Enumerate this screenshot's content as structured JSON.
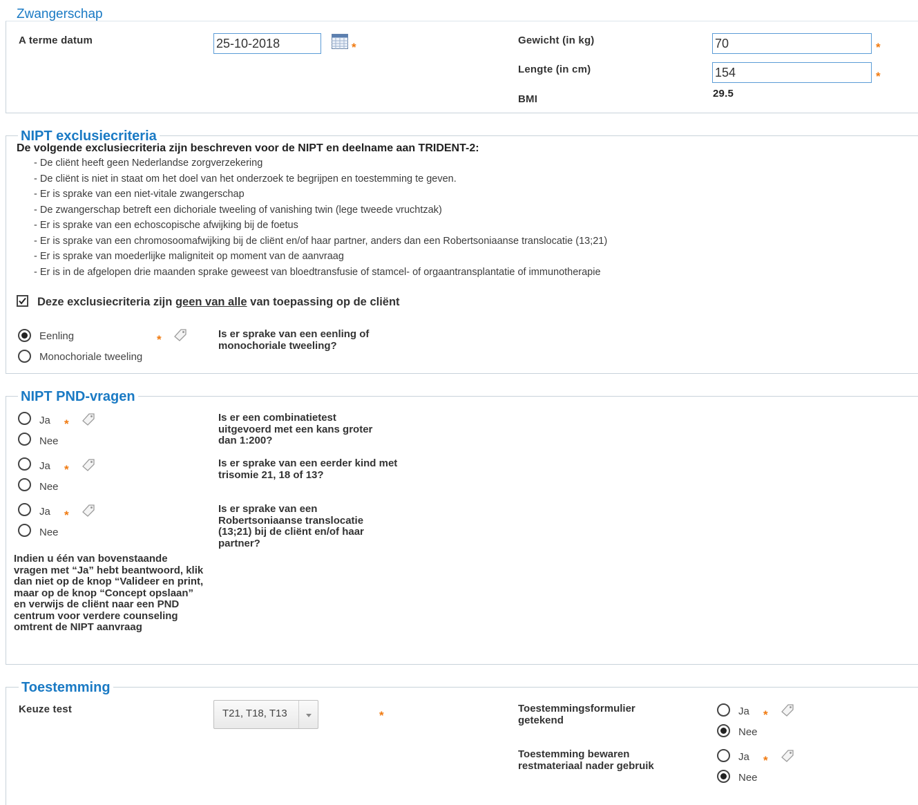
{
  "pregnancy": {
    "title": "Zwangerschap",
    "due_date_label": "A terme datum",
    "due_date_value": "25-10-2018",
    "weight_label": "Gewicht (in kg)",
    "weight_value": "70",
    "length_label": "Lengte (in cm)",
    "length_value": "154",
    "bmi_label": "BMI",
    "bmi_value": "29.5",
    "required_mark": "*"
  },
  "exclusion": {
    "title": "NIPT exclusiecriteria",
    "intro": "De volgende exclusiecriteria zijn beschreven voor de NIPT en deelname aan TRIDENT-2:",
    "criteria": [
      "- De cliënt heeft geen Nederlandse zorgverzekering",
      "- De cliënt is niet in staat om het doel van het onderzoek te begrijpen en toestemming te geven.",
      "- Er is sprake van een niet-vitale zwangerschap",
      "- De zwangerschap betreft een dichoriale tweeling of vanishing twin (lege tweede vruchtzak)",
      "- Er is sprake van een echoscopische afwijking bij de foetus",
      "- Er is sprake van een chromosoomafwijking bij de cliënt en/of haar partner, anders dan een Robertsoniaanse translocatie (13;21)",
      "- Er is sprake van moederlijke maligniteit op moment van de aanvraag",
      "- Er is in de afgelopen drie maanden sprake geweest van bloedtransfusie of stamcel- of orgaantransplantatie of immunotherapie"
    ],
    "confirm_prefix": "Deze exclusiecriteria zijn ",
    "confirm_underlined": "geen van alle",
    "confirm_suffix": " van toepassing op de cliënt",
    "confirm_checked": true,
    "option_1": "Eenling",
    "option_2": "Monochoriale tweeling",
    "selected": "Eenling",
    "question": "Is er sprake van een eenling of monochoriale tweeling?"
  },
  "pnd": {
    "title": "NIPT PND-vragen",
    "yes_label": "Ja",
    "no_label": "Nee",
    "questions": [
      "Is er een combinatietest uitgevoerd met een kans groter dan 1:200?",
      "Is er sprake van een eerder kind met trisomie 21, 18 of 13?",
      "Is er sprake van een Robertsoniaanse translocatie (13;21) bij de cliënt en/of haar partner?"
    ],
    "note": "Indien u één van bovenstaande vragen met “Ja” hebt beantwoord, klik dan niet op de knop “Valideer en print, maar op de knop “Concept opslaan” en verwijs de cliënt naar een PND centrum voor verdere counseling omtrent de NIPT aanvraag"
  },
  "consent": {
    "title": "Toestemming",
    "test_choice_label": "Keuze test",
    "test_choice_value": "T21, T18, T13",
    "form_signed_label": "Toestemmingsformulier getekend",
    "form_signed_selected": "Nee",
    "store_material_label": "Toestemming bewaren restmateriaal nader gebruik",
    "store_material_selected": "Nee",
    "yes_label": "Ja",
    "no_label": "Nee"
  },
  "icons": {
    "calendar": "calendar-icon",
    "tag": "tag-icon",
    "dropdown": "chevron-down-icon"
  },
  "colors": {
    "legend": "#1a7ac4",
    "required": "#f07a10",
    "input_border": "#5a9bd6"
  }
}
